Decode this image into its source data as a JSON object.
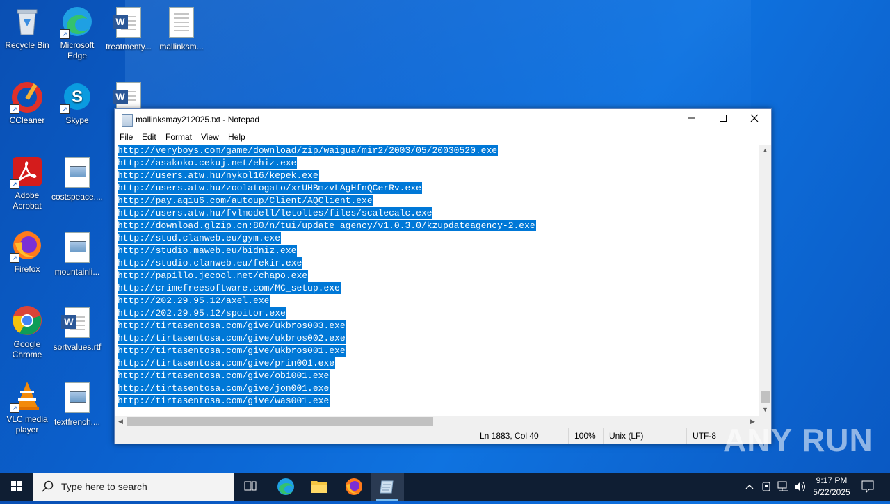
{
  "desktop": {
    "icons": [
      {
        "label": "Recycle Bin",
        "icon": "recycle-bin-icon"
      },
      {
        "label": "Microsoft Edge",
        "icon": "edge-icon"
      },
      {
        "label": "treatmenty...",
        "icon": "word-doc-icon"
      },
      {
        "label": "mallinksm...",
        "icon": "text-file-icon"
      },
      {
        "label": "CCleaner",
        "icon": "ccleaner-icon"
      },
      {
        "label": "Skype",
        "icon": "skype-icon"
      },
      {
        "label": "Adobe Acrobat",
        "icon": "acrobat-icon"
      },
      {
        "label": "costspeace....",
        "icon": "image-file-icon"
      },
      {
        "label": "Firefox",
        "icon": "firefox-icon"
      },
      {
        "label": "mountainli...",
        "icon": "image-file-icon"
      },
      {
        "label": "Google Chrome",
        "icon": "chrome-icon"
      },
      {
        "label": "sortvalues.rtf",
        "icon": "word-doc-icon"
      },
      {
        "label": "VLC media player",
        "icon": "vlc-icon"
      },
      {
        "label": "textfrench....",
        "icon": "image-file-icon"
      }
    ]
  },
  "notepad": {
    "title": "mallinksmay212025.txt - Notepad",
    "menu": [
      "File",
      "Edit",
      "Format",
      "View",
      "Help"
    ],
    "lines": [
      "http://veryboys.com/game/download/zip/waigua/mir2/2003/05/20030520.exe",
      "http://asakoko.cekuj.net/ehiz.exe",
      "http://users.atw.hu/nykol16/kepek.exe",
      "http://users.atw.hu/zoolatogato/xrUHBmzvLAgHfnQCerRv.exe",
      "http://pay.aqiu6.com/autoup/Client/AQClient.exe",
      "http://users.atw.hu/fvlmodell/letoltes/files/scalecalc.exe",
      "http://download.glzip.cn:80/n/tui/update_agency/v1.0.3.0/kzupdateagency-2.exe",
      "http://stud.clanweb.eu/gym.exe",
      "http://studio.maweb.eu/bidniz.exe",
      "http://studio.clanweb.eu/fekir.exe",
      "http://papillo.jecool.net/chapo.exe",
      "http://crimefreesoftware.com/MC_setup.exe",
      "http://202.29.95.12/axel.exe",
      "http://202.29.95.12/spoitor.exe",
      "http://tirtasentosa.com/give/ukbros003.exe",
      "http://tirtasentosa.com/give/ukbros002.exe",
      "http://tirtasentosa.com/give/ukbros001.exe",
      "http://tirtasentosa.com/give/prin001.exe",
      "http://tirtasentosa.com/give/obi001.exe",
      "http://tirtasentosa.com/give/jon001.exe",
      "http://tirtasentosa.com/give/was001.exe"
    ],
    "status": {
      "position": "Ln 1883, Col 40",
      "zoom": "100%",
      "line_ending": "Unix (LF)",
      "encoding": "UTF-8"
    },
    "selection_color": "#0078d7"
  },
  "watermark": {
    "text": "ANY RUN"
  },
  "taskbar": {
    "search_placeholder": "Type here to search",
    "time": "9:17 PM",
    "date": "5/22/2025"
  }
}
